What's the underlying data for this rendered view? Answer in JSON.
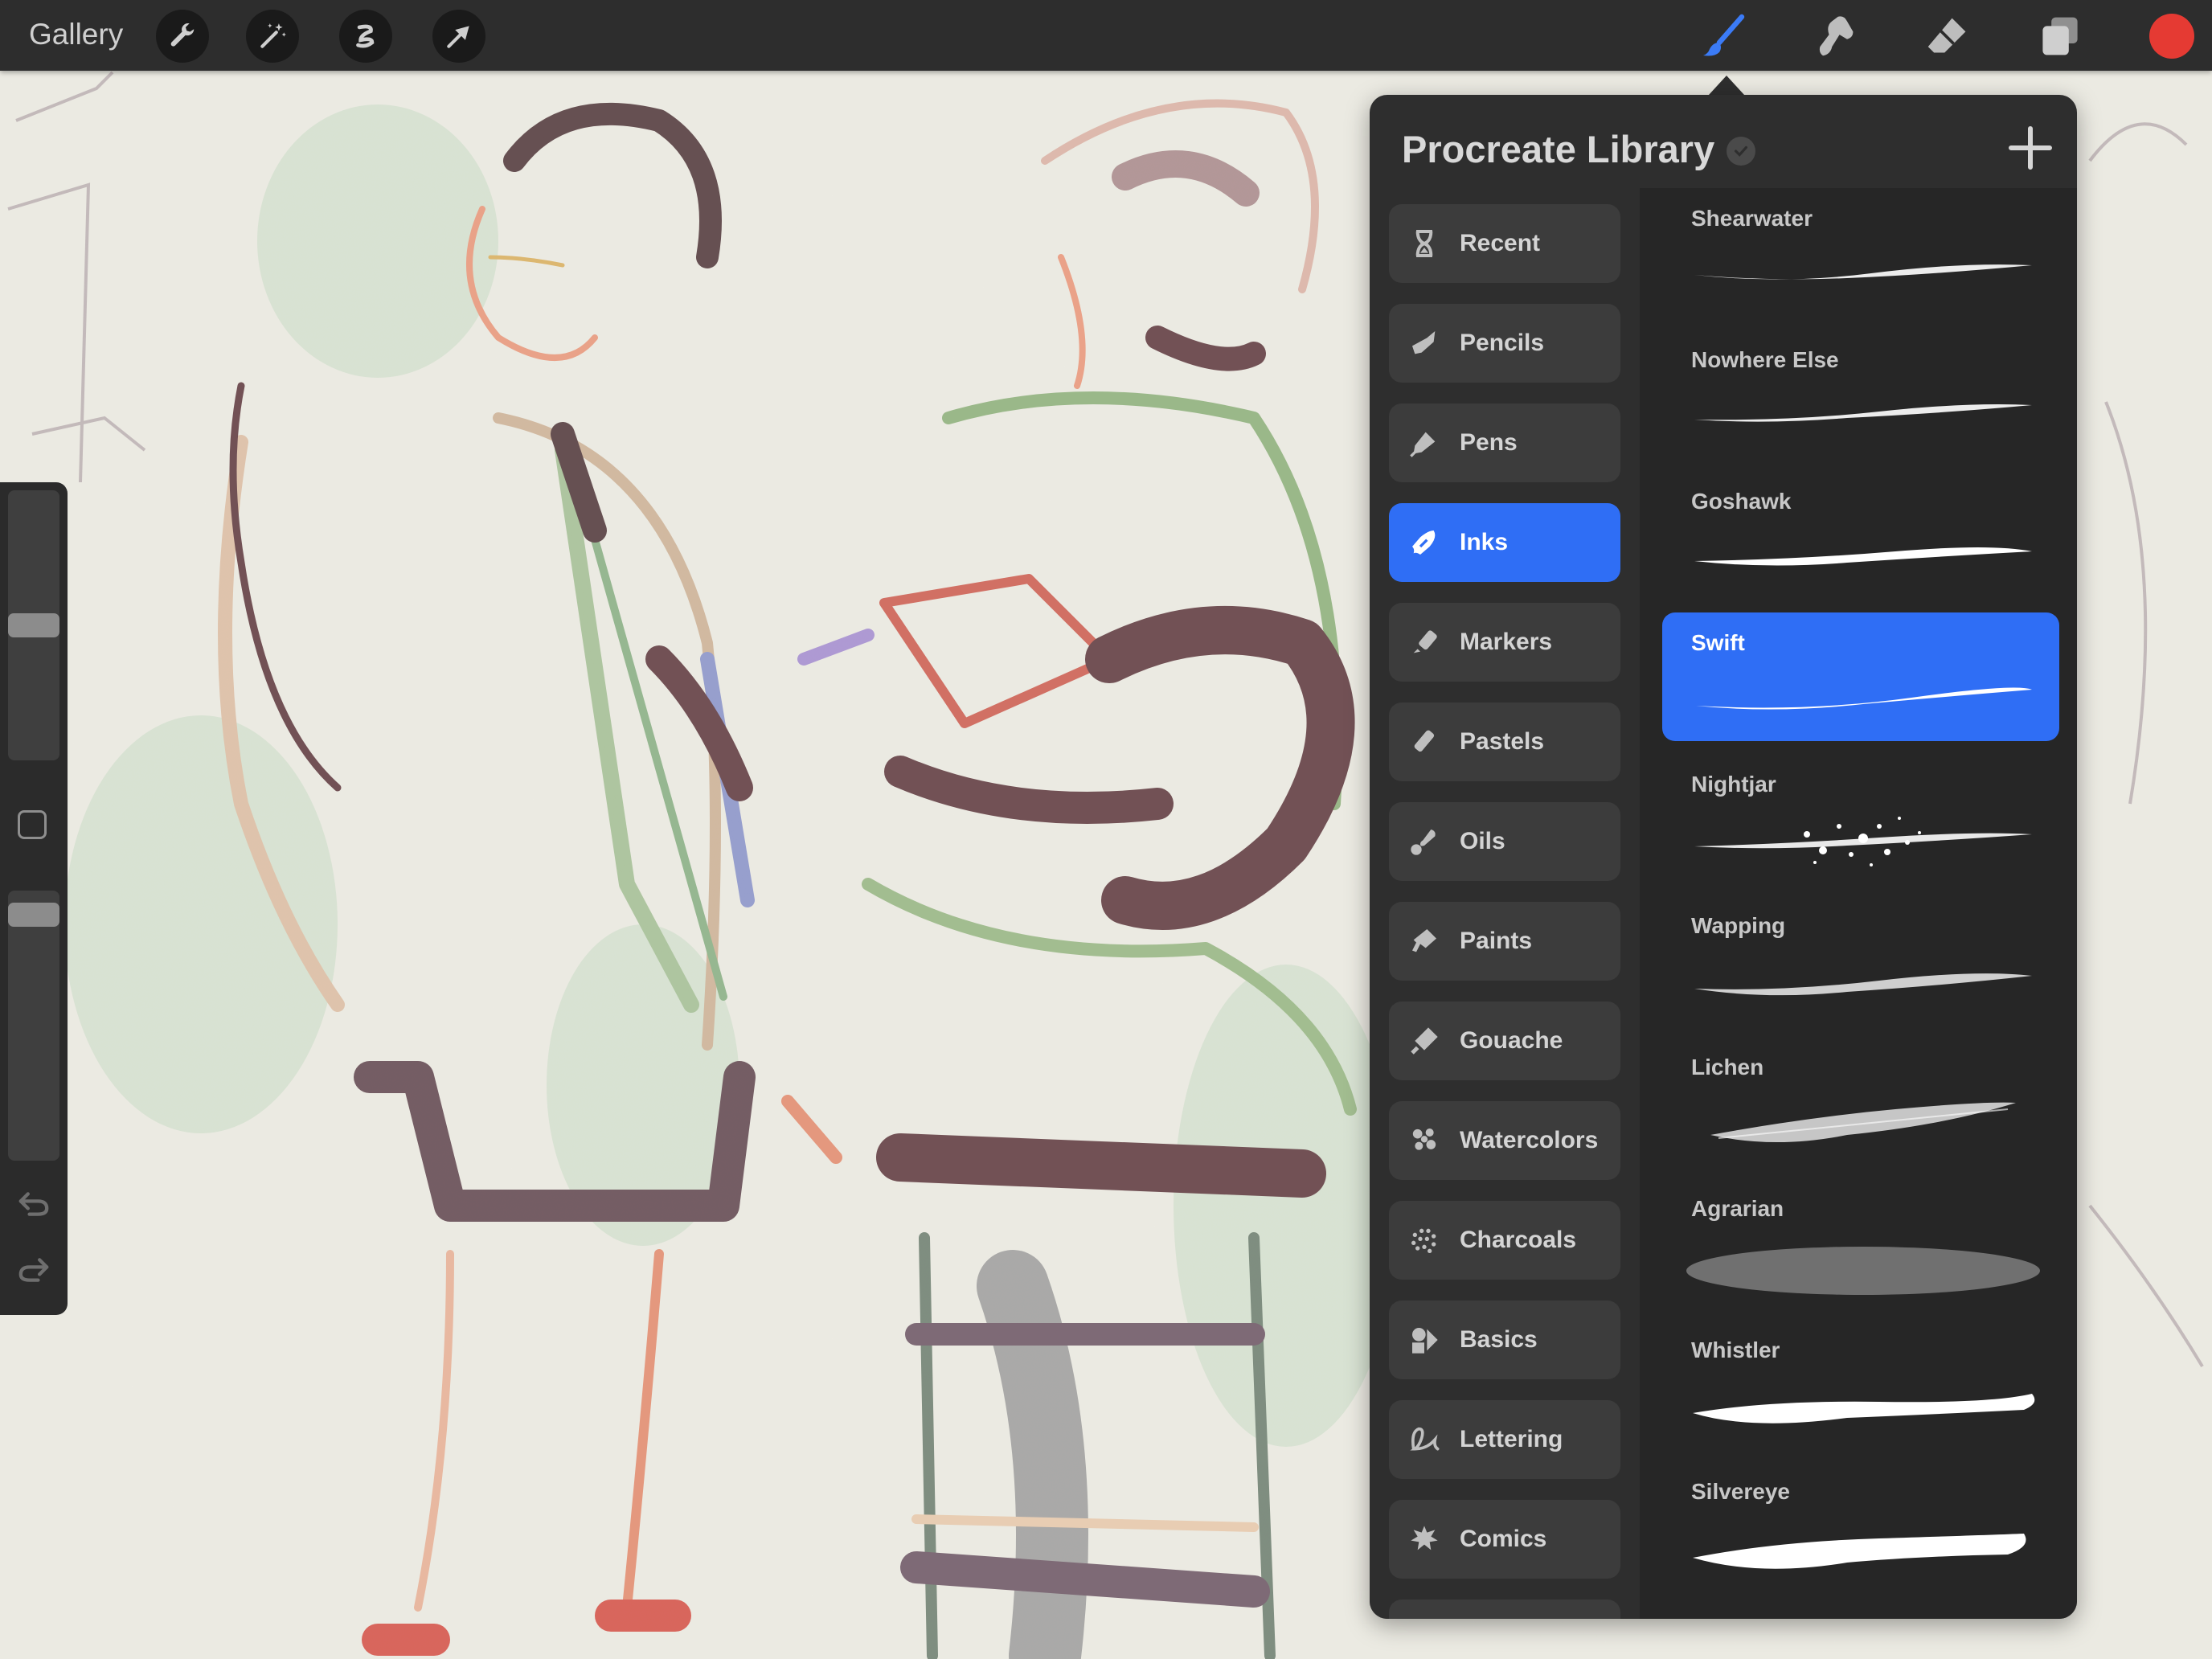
{
  "toolbar": {
    "gallery_label": "Gallery",
    "left_tools": [
      "wrench-icon",
      "magic-wand-icon",
      "selection-icon",
      "transform-arrow-icon"
    ],
    "right_tools": [
      "brush-icon",
      "smudge-icon",
      "eraser-icon",
      "layers-icon"
    ],
    "active_tool": "brush-icon",
    "active_color": "#e53a33"
  },
  "sidebar": {
    "brush_size_level": 0.5,
    "opacity_level": 0.95,
    "undo_icon": "undo-icon",
    "redo_icon": "redo-icon"
  },
  "library": {
    "title": "Procreate Library",
    "add_icon": "plus-icon",
    "accent_color": "#2f6ef5",
    "categories": [
      {
        "label": "Recent",
        "icon": "hourglass-icon"
      },
      {
        "label": "Pencils",
        "icon": "pencil-icon"
      },
      {
        "label": "Pens",
        "icon": "pen-icon"
      },
      {
        "label": "Inks",
        "icon": "ink-nib-icon"
      },
      {
        "label": "Markers",
        "icon": "marker-icon"
      },
      {
        "label": "Pastels",
        "icon": "pastel-icon"
      },
      {
        "label": "Oils",
        "icon": "oil-icon"
      },
      {
        "label": "Paints",
        "icon": "paint-icon"
      },
      {
        "label": "Gouache",
        "icon": "gouache-icon"
      },
      {
        "label": "Watercolors",
        "icon": "watercolor-icon"
      },
      {
        "label": "Charcoals",
        "icon": "charcoal-icon"
      },
      {
        "label": "Basics",
        "icon": "basics-icon"
      },
      {
        "label": "Lettering",
        "icon": "lettering-icon"
      },
      {
        "label": "Comics",
        "icon": "comics-icon"
      }
    ],
    "selected_category": "Inks",
    "brushes": [
      {
        "name": "Shearwater"
      },
      {
        "name": "Nowhere Else"
      },
      {
        "name": "Goshawk"
      },
      {
        "name": "Swift"
      },
      {
        "name": "Nightjar"
      },
      {
        "name": "Wapping"
      },
      {
        "name": "Lichen"
      },
      {
        "name": "Agrarian"
      },
      {
        "name": "Whistler"
      },
      {
        "name": "Silvereye"
      }
    ],
    "selected_brush": "Swift"
  }
}
